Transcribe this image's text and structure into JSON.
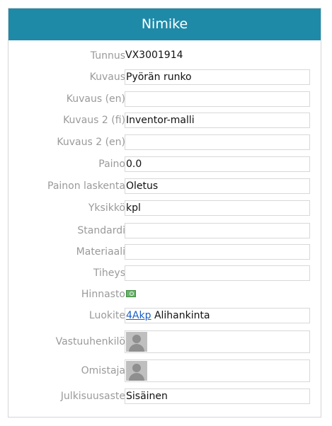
{
  "panel": {
    "title": "Nimike"
  },
  "fields": {
    "tunnus": {
      "label": "Tunnus",
      "value": "VX3001914"
    },
    "kuvaus": {
      "label": "Kuvaus",
      "value": "Pyörän runko"
    },
    "kuvaus_en": {
      "label": "Kuvaus (en)",
      "value": ""
    },
    "kuvaus2_fi": {
      "label": "Kuvaus 2 (fi)",
      "value": "Inventor-malli"
    },
    "kuvaus2_en": {
      "label": "Kuvaus 2 (en)",
      "value": ""
    },
    "paino": {
      "label": "Paino",
      "value": "0.0"
    },
    "painon_laskenta": {
      "label": "Painon laskenta",
      "value": "Oletus"
    },
    "yksikko": {
      "label": "Yksikkö",
      "value": "kpl"
    },
    "standardi": {
      "label": "Standardi",
      "value": ""
    },
    "materiaali": {
      "label": "Materiaali",
      "value": ""
    },
    "tiheys": {
      "label": "Tiheys",
      "value": ""
    },
    "hinnasto": {
      "label": "Hinnasto",
      "icon": "price-list-icon"
    },
    "luokite": {
      "label": "Luokite",
      "link": "4Akp",
      "value": "Alihankinta"
    },
    "vastuuhenkilo": {
      "label": "Vastuuhenkilö",
      "icon": "user-avatar-icon"
    },
    "omistaja": {
      "label": "Omistaja",
      "icon": "user-avatar-icon"
    },
    "julkisuusaste": {
      "label": "Julkisuusaste",
      "value": "Sisäinen"
    }
  }
}
